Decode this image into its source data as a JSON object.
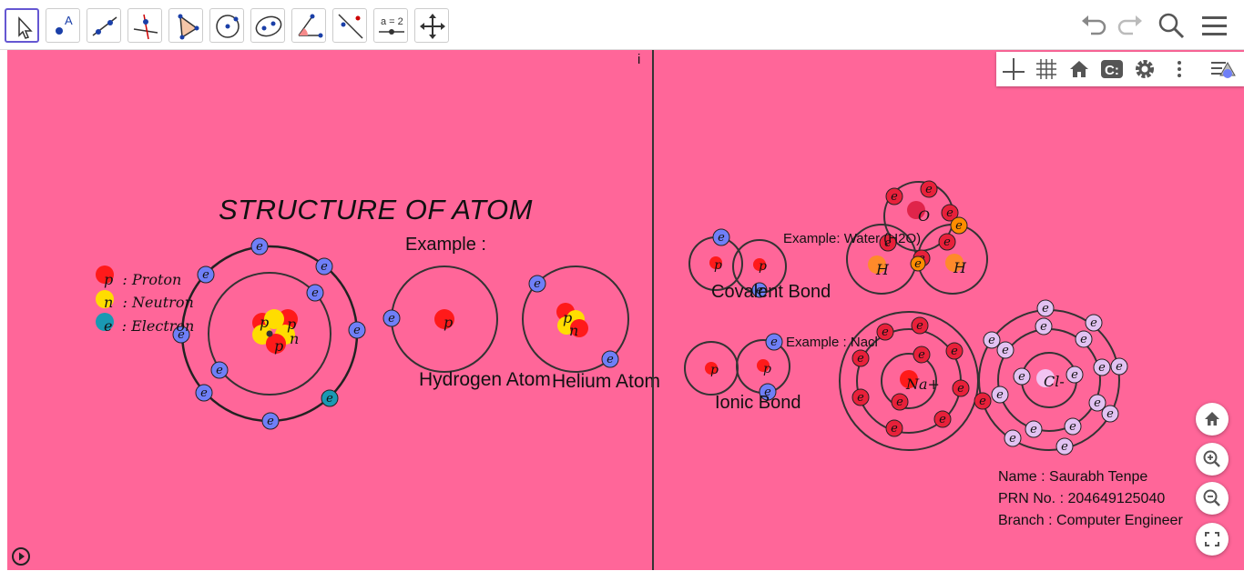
{
  "colors": {
    "canvas": "#ff6699",
    "proton": "#ff1a1a",
    "neutron": "#ffdd00",
    "electron": "#6f7ff7",
    "electron_alt": "#1a99b3",
    "shell": "#333333",
    "toolbar_select": "#6557d2"
  },
  "toolbar": {
    "tools": [
      {
        "name": "move-tool-icon"
      },
      {
        "name": "point-tool-icon",
        "text": "A"
      },
      {
        "name": "line-tool-icon"
      },
      {
        "name": "perpendicular-line-tool-icon"
      },
      {
        "name": "polygon-tool-icon"
      },
      {
        "name": "circle-tool-icon"
      },
      {
        "name": "ellipse-tool-icon"
      },
      {
        "name": "angle-tool-icon"
      },
      {
        "name": "reflect-tool-icon"
      },
      {
        "name": "slider-tool-icon",
        "text": "a = 2"
      },
      {
        "name": "move-graphics-view-tool-icon"
      }
    ],
    "right": [
      "undo-icon",
      "redo-icon",
      "search-icon",
      "menu-icon"
    ]
  },
  "graphics_panel": [
    "axes-icon",
    "grid-icon",
    "home-icon",
    "snap-icon",
    "gear-icon",
    "more-vertical-icon",
    "style-bar-icon"
  ],
  "canvas": {
    "info_marker": "i",
    "title": "STRUCTURE  OF  ATOM",
    "example_label": "Example :",
    "legend": [
      {
        "symbol": "p",
        "text": ": Proton"
      },
      {
        "symbol": "n",
        "text": ": Neutron"
      },
      {
        "symbol": "e",
        "text": ": Electron"
      }
    ],
    "hydrogen_label": "Hydrogen Atom",
    "helium_label": "Helium Atom",
    "covalent_label": "Covalent Bond",
    "ionic_label": "Ionic Bond",
    "water_example": "Example: Water (H2O)",
    "nacl_example": "Example : Nacl",
    "particle_labels": {
      "proton": "p",
      "neutron": "n",
      "electron": "e",
      "oxygen": "O",
      "hydrogen": "H",
      "sodium": "Na+",
      "chlorine": "Cl-"
    },
    "author": {
      "name": "Name : Saurabh Tenpe",
      "prn": "PRN No. : 204649125040",
      "branch": "Branch : Computer Engineer"
    }
  },
  "zoom_controls": [
    "home-view-icon",
    "zoom-in-icon",
    "zoom-out-icon",
    "fullscreen-icon"
  ],
  "play_icon": "play-icon"
}
